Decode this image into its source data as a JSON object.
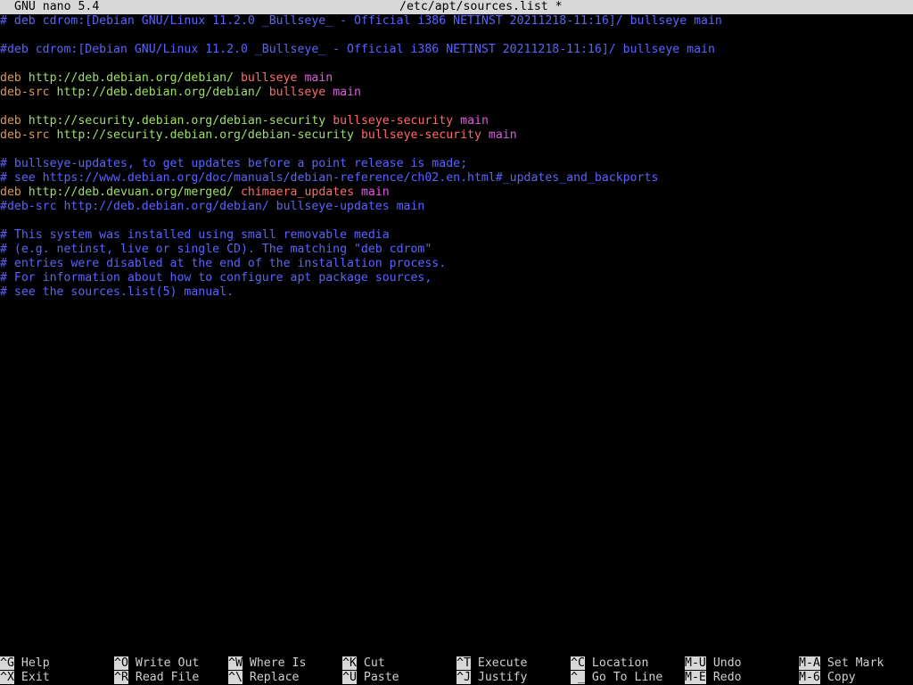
{
  "titlebar": {
    "version": "GNU nano 5.4",
    "filename": "/etc/apt/sources.list *"
  },
  "colors": {
    "background": "#000000",
    "comment": "#5b63ff",
    "keyword": "#d99a5a",
    "url": "#9ee06a",
    "suite": "#ff6b6b",
    "component": "#e05be0",
    "titlebar_bg": "#d8d8d8"
  },
  "lines": [
    {
      "type": "comment",
      "text": "# deb cdrom:[Debian GNU/Linux 11.2.0 _Bullseye_ - Official i386 NETINST 20211218-11:16]/ bullseye main"
    },
    {
      "type": "blank",
      "text": ""
    },
    {
      "type": "comment",
      "text": "#deb cdrom:[Debian GNU/Linux 11.2.0 _Bullseye_ - Official i386 NETINST 20211218-11:16]/ bullseye main"
    },
    {
      "type": "blank",
      "text": ""
    },
    {
      "type": "source",
      "kw": "deb",
      "url": "http://deb.debian.org/debian/",
      "suite": "bullseye",
      "comp": "main"
    },
    {
      "type": "source",
      "kw": "deb-src",
      "url": "http://deb.debian.org/debian/",
      "suite": "bullseye",
      "comp": "main"
    },
    {
      "type": "blank",
      "text": ""
    },
    {
      "type": "source",
      "kw": "deb",
      "url": "http://security.debian.org/debian-security",
      "suite": "bullseye-security",
      "comp": "main"
    },
    {
      "type": "source",
      "kw": "deb-src",
      "url": "http://security.debian.org/debian-security",
      "suite": "bullseye-security",
      "comp": "main"
    },
    {
      "type": "blank",
      "text": ""
    },
    {
      "type": "comment",
      "text": "# bullseye-updates, to get updates before a point release is made;"
    },
    {
      "type": "comment",
      "text": "# see https://www.debian.org/doc/manuals/debian-reference/ch02.en.html#_updates_and_backports"
    },
    {
      "type": "source",
      "kw": "deb",
      "url": "http://deb.devuan.org/merged/",
      "suite": "chimaera_updates",
      "comp": "main"
    },
    {
      "type": "comment",
      "text": "#deb-src http://deb.debian.org/debian/ bullseye-updates main"
    },
    {
      "type": "blank",
      "text": ""
    },
    {
      "type": "comment",
      "text": "# This system was installed using small removable media"
    },
    {
      "type": "comment",
      "text": "# (e.g. netinst, live or single CD). The matching \"deb cdrom\""
    },
    {
      "type": "comment",
      "text": "# entries were disabled at the end of the installation process."
    },
    {
      "type": "comment",
      "text": "# For information about how to configure apt package sources,"
    },
    {
      "type": "comment",
      "text": "# see the sources.list(5) manual."
    }
  ],
  "shortcuts": {
    "row1": [
      {
        "key": "^G",
        "label": "Help"
      },
      {
        "key": "^O",
        "label": "Write Out"
      },
      {
        "key": "^W",
        "label": "Where Is"
      },
      {
        "key": "^K",
        "label": "Cut"
      },
      {
        "key": "^T",
        "label": "Execute"
      },
      {
        "key": "^C",
        "label": "Location"
      },
      {
        "key": "M-U",
        "label": "Undo"
      },
      {
        "key": "M-A",
        "label": "Set Mark"
      }
    ],
    "row2": [
      {
        "key": "^X",
        "label": "Exit"
      },
      {
        "key": "^R",
        "label": "Read File"
      },
      {
        "key": "^\\",
        "label": "Replace"
      },
      {
        "key": "^U",
        "label": "Paste"
      },
      {
        "key": "^J",
        "label": "Justify"
      },
      {
        "key": "^_",
        "label": "Go To Line"
      },
      {
        "key": "M-E",
        "label": "Redo"
      },
      {
        "key": "M-6",
        "label": "Copy"
      }
    ]
  }
}
